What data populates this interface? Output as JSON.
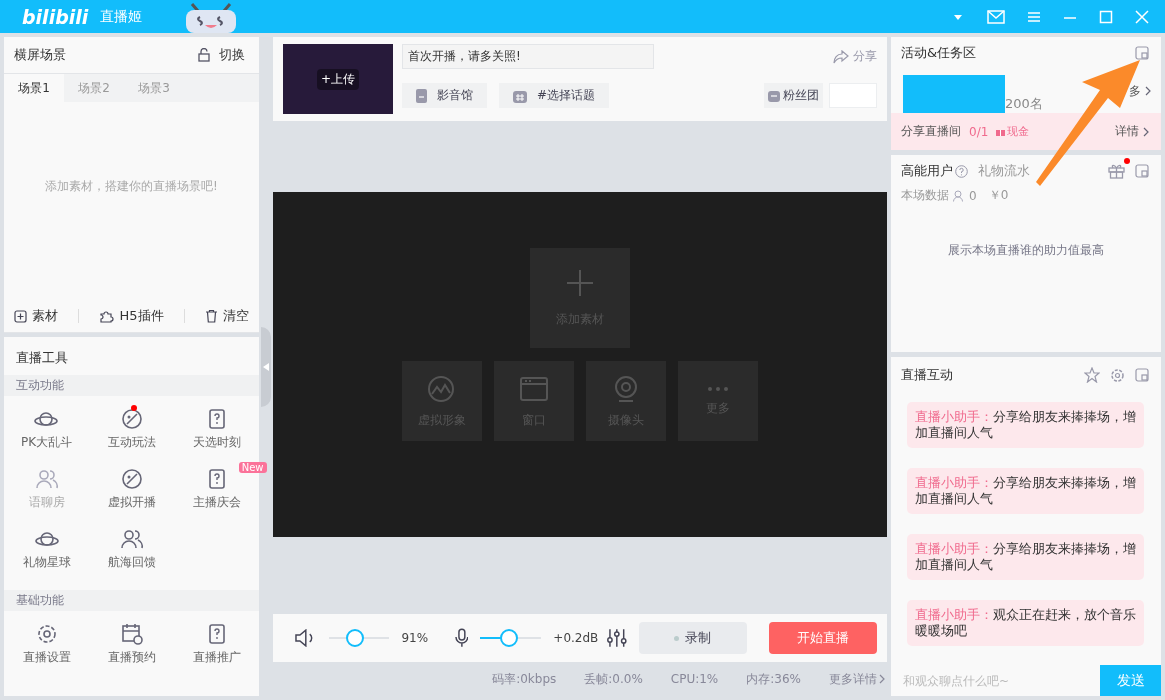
{
  "titlebar": {
    "logo": "bilibili",
    "app_name": "直播姬"
  },
  "scene_panel": {
    "title": "横屏场景",
    "switch_label": "切换",
    "tabs": [
      {
        "label": "场景1",
        "selected": true
      },
      {
        "label": "场景2",
        "selected": false
      },
      {
        "label": "场景3",
        "selected": false
      }
    ],
    "empty_hint": "添加素材，搭建你的直播场景吧!",
    "actions": [
      "素材",
      "H5插件",
      "清空"
    ]
  },
  "tools": {
    "title": "直播工具",
    "sections": [
      {
        "title": "互动功能",
        "items": [
          {
            "label": "PK大乱斗",
            "disabled": false,
            "notify": false
          },
          {
            "label": "互动玩法",
            "disabled": false,
            "notify": true
          },
          {
            "label": "天选时刻",
            "disabled": false,
            "notify": false
          },
          {
            "label": "语聊房",
            "disabled": true,
            "notify": false
          },
          {
            "label": "虚拟开播",
            "disabled": false,
            "notify": false
          },
          {
            "label": "主播庆会",
            "disabled": false,
            "notify": false,
            "badge": "New"
          },
          {
            "label": "礼物星球",
            "disabled": false,
            "notify": false
          },
          {
            "label": "航海回馈",
            "disabled": false,
            "notify": false
          }
        ]
      },
      {
        "title": "基础功能",
        "items": [
          {
            "label": "直播设置",
            "disabled": false,
            "notify": false
          },
          {
            "label": "直播预约",
            "disabled": false,
            "notify": false
          },
          {
            "label": "直播推广",
            "disabled": false,
            "notify": false
          }
        ]
      }
    ]
  },
  "stream_info": {
    "cover_label": "+上传",
    "title_value": "首次开播，请多关照!",
    "share_label": "分享",
    "tags": [
      "影音馆",
      "#选择话题"
    ],
    "fan_club": "粉丝团"
  },
  "preview": {
    "add_label": "添加素材",
    "sources": [
      "虚拟形象",
      "窗口",
      "摄像头",
      "更多"
    ]
  },
  "controls": {
    "volume": {
      "level": 0.44,
      "reading": "91%"
    },
    "mic": {
      "level": 0.47,
      "reading": "+0.2dB"
    },
    "record_label": "录制",
    "start_label": "开始直播"
  },
  "status_bar": [
    "码率:0kbps",
    "丢帧:0.0%",
    "CPU:1%",
    "内存:36%",
    "更多详情"
  ],
  "activity": {
    "title": "活动&任务区",
    "partial_rank": "200名",
    "partial_more": "多",
    "task": {
      "label": "分享直播间",
      "progress": "0/1",
      "reward": "现金",
      "details": "详情"
    }
  },
  "ranking": {
    "tabs": [
      {
        "label": "高能用户",
        "selected": true
      },
      {
        "label": "礼物流水",
        "selected": false
      }
    ],
    "gift_notify": true,
    "stats_label": "本场数据",
    "viewers": "0",
    "money": "￥0",
    "empty_text": "展示本场直播谁的助力值最高"
  },
  "interaction": {
    "title": "直播互动",
    "messages": [
      {
        "sender": "直播小助手：",
        "text": "分享给朋友来捧捧场，增加直播间人气"
      },
      {
        "sender": "直播小助手：",
        "text": "分享给朋友来捧捧场，增加直播间人气"
      },
      {
        "sender": "直播小助手：",
        "text": "分享给朋友来捧捧场，增加直播间人气"
      },
      {
        "sender": "直播小助手：",
        "text": "观众正在赶来，放个音乐暖暖场吧"
      }
    ],
    "placeholder": "和观众聊点什么吧~",
    "send_label": "发送"
  }
}
